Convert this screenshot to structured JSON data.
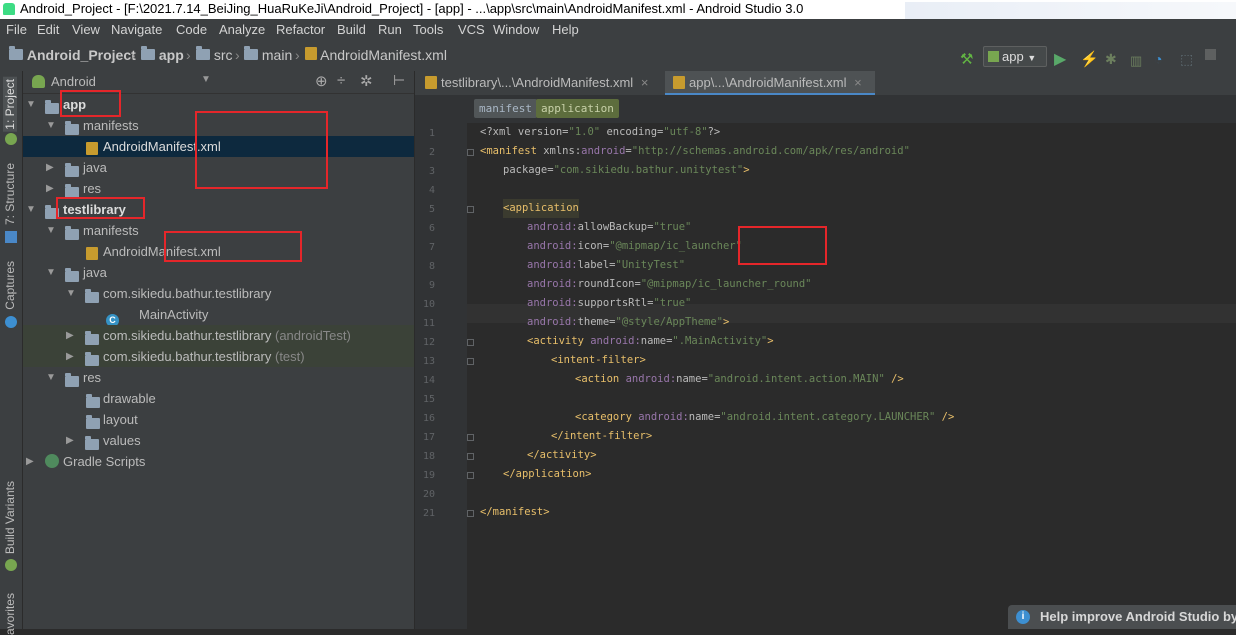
{
  "window": {
    "title": "Android_Project - [F:\\2021.7.14_BeiJing_HuaRuKeJi\\Android_Project] - [app] - ...\\app\\src\\main\\AndroidManifest.xml - Android Studio 3.0"
  },
  "menu": [
    "File",
    "Edit",
    "View",
    "Navigate",
    "Code",
    "Analyze",
    "Refactor",
    "Build",
    "Run",
    "Tools",
    "VCS",
    "Window",
    "Help"
  ],
  "breadcrumbs": [
    "Android_Project",
    "app",
    "src",
    "main",
    "AndroidManifest.xml"
  ],
  "toolbar": {
    "run_config": "app"
  },
  "left_tabs": {
    "project": "1: Project",
    "structure": "7: Structure",
    "captures": "Captures",
    "build_variants": "Build Variants",
    "favorites": "avorites"
  },
  "project_panel": {
    "view_mode": "Android"
  },
  "tree": {
    "app": "app",
    "app_manifests": "manifests",
    "app_manifest_file": "AndroidManifest.xml",
    "app_java": "java",
    "app_res": "res",
    "lib": "testlibrary",
    "lib_manifests": "manifests",
    "lib_manifest_file": "AndroidManifest.xml",
    "lib_java": "java",
    "pkg1": "com.sikiedu.bathur.testlibrary",
    "main_activity": "MainActivity",
    "pkg2": "com.sikiedu.bathur.testlibrary",
    "pkg2_suffix": "(androidTest)",
    "pkg3": "com.sikiedu.bathur.testlibrary",
    "pkg3_suffix": "(test)",
    "lib_res": "res",
    "drawable": "drawable",
    "layout": "layout",
    "values": "values",
    "gradle": "Gradle Scripts"
  },
  "editor_tabs": [
    {
      "label": "testlibrary\\...\\AndroidManifest.xml",
      "active": false
    },
    {
      "label": "app\\...\\AndroidManifest.xml",
      "active": true
    }
  ],
  "xml_crumbs": [
    "manifest",
    "application"
  ],
  "line_numbers": [
    "1",
    "2",
    "3",
    "4",
    "5",
    "6",
    "7",
    "8",
    "9",
    "10",
    "11",
    "12",
    "13",
    "14",
    "15",
    "16",
    "17",
    "18",
    "19",
    "20",
    "21"
  ],
  "code": {
    "l1_a": "<?xml version=",
    "l1_b": "\"1.0\"",
    "l1_c": " encoding=",
    "l1_d": "\"utf-8\"",
    "l1_e": "?>",
    "l2_tag": "<manifest ",
    "l2_ns": "xmlns:",
    "l2_attr": "android",
    "l2_eq": "=",
    "l2_val": "\"http://schemas.android.com/apk/res/android\"",
    "l3_attr": "package=",
    "l3_val": "\"com.sikiedu.bathur.unitytest\"",
    "l3_end": ">",
    "l5_tag": "<application",
    "l6_ns": "android:",
    "l6_attr": "allowBackup=",
    "l6_val": "\"true\"",
    "l7_ns": "android:",
    "l7_attr": "icon=",
    "l7_val": "\"@mipmap/ic_launcher\"",
    "l8_ns": "android:",
    "l8_attr": "label=",
    "l8_val": "\"UnityTest\"",
    "l9_ns": "android:",
    "l9_attr": "roundIcon=",
    "l9_val": "\"@mipmap/ic_launcher_round\"",
    "l10_ns": "android:",
    "l10_attr": "supportsRtl=",
    "l10_val": "\"true\"",
    "l11_ns": "android:",
    "l11_attr": "theme=",
    "l11_val": "\"@style/AppTheme\"",
    "l11_end": ">",
    "l12_tag": "<activity ",
    "l12_ns": "android:",
    "l12_attr": "name=",
    "l12_val": "\".MainActivity\"",
    "l12_end": ">",
    "l13_tag": "<intent-filter>",
    "l14_tag": "<action ",
    "l14_ns": "android:",
    "l14_attr": "name=",
    "l14_val": "\"android.intent.action.MAIN\"",
    "l14_end": " />",
    "l16_tag": "<category ",
    "l16_ns": "android:",
    "l16_attr": "name=",
    "l16_val": "\"android.intent.category.LAUNCHER\"",
    "l16_end": " />",
    "l17_tag": "</intent-filter>",
    "l18_tag": "</activity>",
    "l19_tag": "</application>",
    "l21_tag": "</manifest>"
  },
  "notification": {
    "text": "Help improve Android Studio by"
  },
  "colors": {
    "highlight": "#e5262a",
    "selection": "#0d293e",
    "accent": "#4a88c7"
  }
}
